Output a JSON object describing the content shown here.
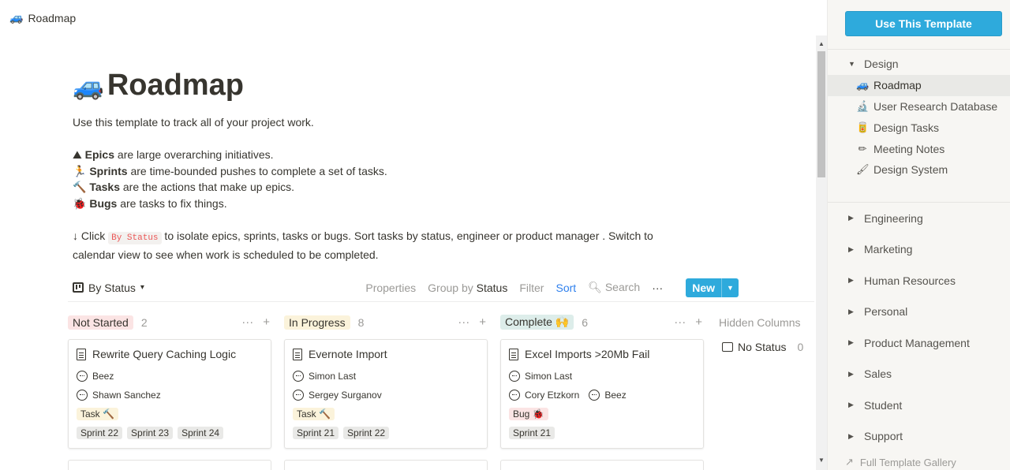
{
  "topbar": {
    "icon": "car-icon",
    "title": "Roadmap"
  },
  "page": {
    "title": "Roadmap",
    "description": "Use this template to track all of your project work.",
    "bullets": [
      {
        "emoji": "⛰",
        "bold": "Epics",
        "text": " are large overarching initiatives."
      },
      {
        "emoji": "🏃",
        "bold": "Sprints",
        "text": " are time-bounded pushes to complete a set of tasks."
      },
      {
        "emoji": "🔨",
        "bold": "Tasks",
        "text": " are the actions that make up epics."
      },
      {
        "emoji": "🐞",
        "bold": "Bugs",
        "text": " are tasks to fix things."
      }
    ],
    "instructions_prefix": "↓ Click ",
    "instructions_code": "By Status",
    "instructions_suffix": " to isolate epics, sprints, tasks or bugs. Sort tasks by status, engineer or product manager . Switch to calendar view to see when work is scheduled to be completed."
  },
  "toolbar": {
    "view_label": "By Status",
    "properties": "Properties",
    "group_by": "Group by",
    "group_by_value": "Status",
    "filter": "Filter",
    "sort": "Sort",
    "search": "Search",
    "more": "···",
    "new": "New"
  },
  "board": {
    "columns": [
      {
        "name": "Not Started",
        "count": "2",
        "color": "#fbe4e4",
        "card": {
          "title": "Rewrite Query Caching Logic",
          "people": [
            "Beez",
            "Shawn Sanchez"
          ],
          "type": "Task 🔨",
          "type_color": "#fbf3db",
          "sprints": [
            "Sprint 22",
            "Sprint 23",
            "Sprint 24"
          ]
        }
      },
      {
        "name": "In Progress",
        "count": "8",
        "color": "#fbf3db",
        "card": {
          "title": "Evernote Import",
          "people": [
            "Simon Last",
            "Sergey Surganov"
          ],
          "type": "Task 🔨",
          "type_color": "#fbf3db",
          "sprints": [
            "Sprint 21",
            "Sprint 22"
          ]
        }
      },
      {
        "name": "Complete 🙌",
        "count": "6",
        "color": "#ddedea",
        "card": {
          "title": "Excel Imports >20Mb Fail",
          "people": [
            "Simon Last",
            "Cory Etzkorn",
            "Beez"
          ],
          "type": "Bug 🐞",
          "type_color": "#fbe4e4",
          "sprints": [
            "Sprint 21"
          ]
        }
      }
    ],
    "hidden_columns_label": "Hidden Columns",
    "no_status_label": "No Status",
    "no_status_count": "0",
    "column_more": "···",
    "column_add": "+"
  },
  "sidebar": {
    "use_template": "Use This Template",
    "design_section": "Design",
    "design_items": [
      {
        "label": "Roadmap",
        "icon": "🚙",
        "active": true
      },
      {
        "label": "User Research Database",
        "icon": "🔬",
        "active": false
      },
      {
        "label": "Design Tasks",
        "icon": "🥫",
        "active": false
      },
      {
        "label": "Meeting Notes",
        "icon": "✏",
        "active": false
      },
      {
        "label": "Design System",
        "icon": "🖌",
        "active": false
      }
    ],
    "categories": [
      "Engineering",
      "Marketing",
      "Human Resources",
      "Personal",
      "Product Management",
      "Sales",
      "Student",
      "Support"
    ],
    "footer": "Full Template Gallery"
  }
}
